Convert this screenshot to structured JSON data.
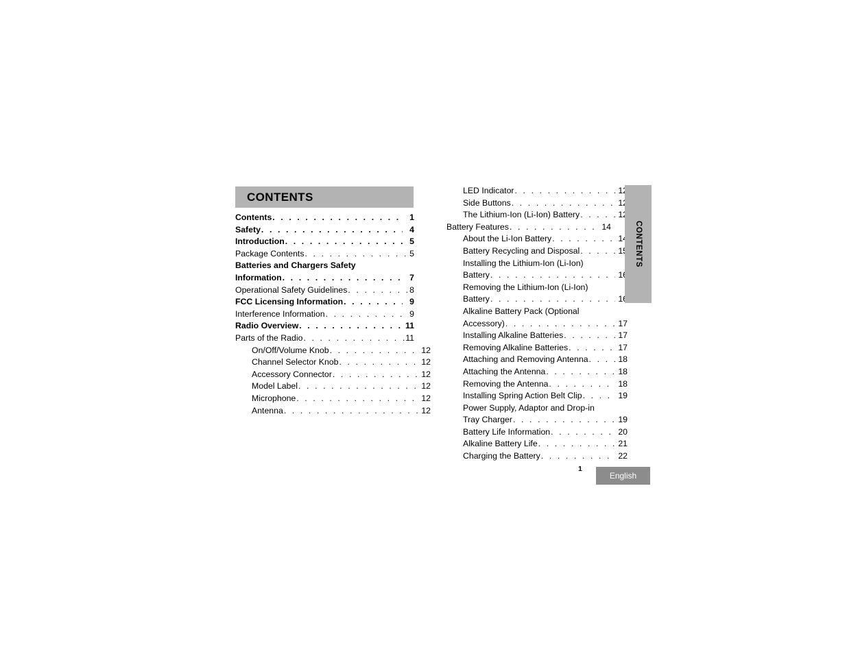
{
  "header": {
    "title": "CONTENTS"
  },
  "side_tab": {
    "label": "CONTENTS"
  },
  "footer": {
    "page_number": "1",
    "language": "English"
  },
  "colors": {
    "header_bar": "#b3b3b3",
    "side_tab": "#b3b3b3",
    "language_badge": "#8c8c8c"
  },
  "left_column": [
    {
      "label": "Contents",
      "page": "1",
      "level": 0,
      "bold": true
    },
    {
      "label": "Safety",
      "page": "4",
      "level": 0,
      "bold": true
    },
    {
      "label": "Introduction",
      "page": "5",
      "level": 0,
      "bold": true
    },
    {
      "label": "Package Contents",
      "page": "5",
      "level": 1,
      "bold": false
    },
    {
      "label": "Batteries and Chargers Safety",
      "label2": "Information",
      "page": "7",
      "level": 0,
      "bold": true,
      "wrapped": true
    },
    {
      "label": "Operational Safety Guidelines",
      "page": "8",
      "level": 1,
      "bold": false
    },
    {
      "label": "FCC Licensing Information",
      "page": "9",
      "level": 0,
      "bold": true
    },
    {
      "label": "Interference Information",
      "page": "9",
      "level": 1,
      "bold": false
    },
    {
      "label": "Radio Overview",
      "page": "11",
      "level": 0,
      "bold": true
    },
    {
      "label": "Parts of the Radio",
      "page": "11",
      "level": 1,
      "bold": false
    },
    {
      "label": "On/Off/Volume Knob",
      "page": "12",
      "level": 2,
      "bold": false
    },
    {
      "label": "Channel Selector Knob",
      "page": "12",
      "level": 2,
      "bold": false
    },
    {
      "label": "Accessory Connector",
      "page": "12",
      "level": 2,
      "bold": false
    },
    {
      "label": "Model Label",
      "page": "12",
      "level": 2,
      "bold": false
    },
    {
      "label": "Microphone",
      "page": "12",
      "level": 2,
      "bold": false
    },
    {
      "label": "Antenna",
      "page": "12",
      "level": 2,
      "bold": false
    }
  ],
  "right_column": [
    {
      "label": "LED Indicator",
      "page": "12",
      "level": 2,
      "bold": false
    },
    {
      "label": "Side Buttons",
      "page": "12",
      "level": 2,
      "bold": false
    },
    {
      "label": "The Lithium-Ion (Li-Ion) Battery",
      "page": "12",
      "level": 2,
      "bold": false
    },
    {
      "label": "Battery Features",
      "page": "14",
      "level": 1,
      "bold": false
    },
    {
      "label": "About the Li-Ion Battery",
      "page": "14",
      "level": 2,
      "bold": false
    },
    {
      "label": "Battery Recycling and Disposal",
      "page": "15",
      "level": 2,
      "bold": false
    },
    {
      "label": "Installing the Lithium-Ion (Li-Ion)",
      "label2": "Battery",
      "page": "16",
      "level": 2,
      "bold": false,
      "wrapped": true
    },
    {
      "label": "Removing the Lithium-Ion (Li-Ion)",
      "label2": "Battery",
      "page": "16",
      "level": 2,
      "bold": false,
      "wrapped": true
    },
    {
      "label": "Alkaline Battery Pack (Optional",
      "label2": "Accessory)",
      "page": "17",
      "level": 2,
      "bold": false,
      "wrapped": true
    },
    {
      "label": "Installing Alkaline Batteries",
      "page": "17",
      "level": 2,
      "bold": false
    },
    {
      "label": "Removing Alkaline Batteries",
      "page": "17",
      "level": 2,
      "bold": false
    },
    {
      "label": "Attaching and Removing Antenna",
      "page": "18",
      "level": 2,
      "bold": false
    },
    {
      "label": "Attaching the Antenna",
      "page": "18",
      "level": 2,
      "bold": false
    },
    {
      "label": "Removing the Antenna",
      "page": "18",
      "level": 2,
      "bold": false
    },
    {
      "label": "Installing Spring Action Belt Clip",
      "page": "19",
      "level": 2,
      "bold": false
    },
    {
      "label": "Power Supply, Adaptor and Drop-in",
      "label2": "Tray Charger",
      "page": "19",
      "level": 2,
      "bold": false,
      "wrapped": true
    },
    {
      "label": "Battery Life Information",
      "page": "20",
      "level": 2,
      "bold": false
    },
    {
      "label": "Alkaline Battery Life",
      "page": "21",
      "level": 2,
      "bold": false
    },
    {
      "label": "Charging the Battery",
      "page": "22",
      "level": 2,
      "bold": false
    }
  ]
}
